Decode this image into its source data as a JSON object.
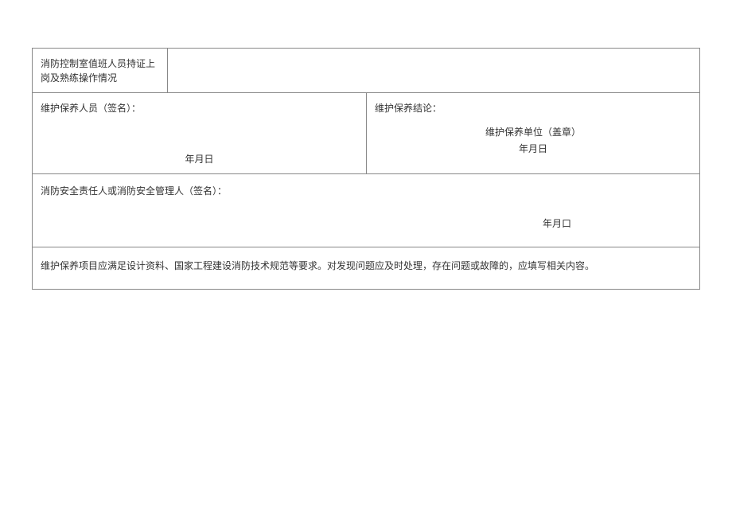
{
  "rows": {
    "r1": {
      "label": "消防控制室值班人员持证上岗及熟练操作情况"
    },
    "r2": {
      "left_title": "维护保养人员（签名）：",
      "left_date": "年月日",
      "right_title": "维护保养结论：",
      "right_unit": "维护保养单位（盖章）",
      "right_date": "年月日"
    },
    "r3": {
      "sig_label": "消防安全责任人或消防安全管理人（签名）：",
      "date": "年月口"
    },
    "r4": {
      "note": "维护保养项目应满足设计资料、国家工程建设消防技术规范等要求。对发现问题应及时处理，存在问题或故障的，应填写相关内容。"
    }
  }
}
